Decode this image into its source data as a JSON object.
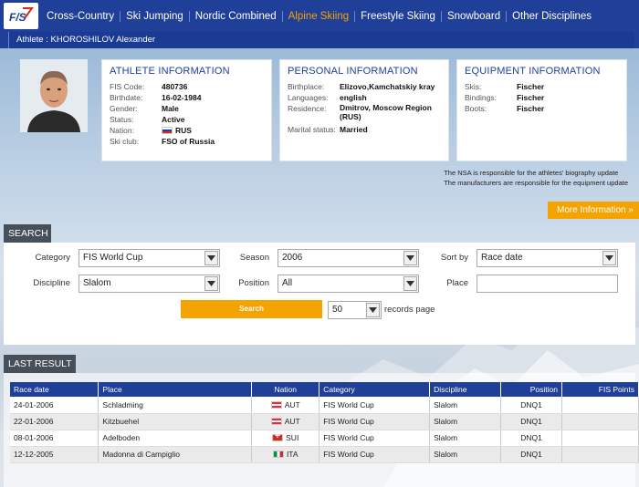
{
  "nav": {
    "logo_text": "FIS",
    "items": [
      {
        "label": "Cross-Country",
        "active": false
      },
      {
        "label": "Ski Jumping",
        "active": false
      },
      {
        "label": "Nordic Combined",
        "active": false
      },
      {
        "label": "Alpine Skiing",
        "active": true
      },
      {
        "label": "Freestyle Skiing",
        "active": false
      },
      {
        "label": "Snowboard",
        "active": false
      },
      {
        "label": "Other Disciplines",
        "active": false
      }
    ]
  },
  "athlete_bar": {
    "text": "Athlete : KHOROSHILOV Alexander"
  },
  "athlete_info": {
    "title": "ATHLETE INFORMATION",
    "fis_code_label": "FIS Code:",
    "fis_code": "480736",
    "birthdate_label": "Birthdate:",
    "birthdate": "16-02-1984",
    "gender_label": "Gender:",
    "gender": "Male",
    "status_label": "Status:",
    "status": "Active",
    "nation_label": "Nation:",
    "nation": "RUS",
    "club_label": "Ski club:",
    "club": "FSO of Russia"
  },
  "personal_info": {
    "title": "PERSONAL INFORMATION",
    "birthplace_label": "Birthplace:",
    "birthplace": "Elizovo,Kamchatskiy kray",
    "languages_label": "Languages:",
    "languages": "english",
    "residence_label": "Residence:",
    "residence": "Dmitrov, Moscow Region (RUS)",
    "marital_label": "Marital status:",
    "marital": "Married"
  },
  "equipment_info": {
    "title": "EQUIPMENT INFORMATION",
    "skis_label": "Skis:",
    "skis": "Fischer",
    "bindings_label": "Bindings:",
    "bindings": "Fischer",
    "boots_label": "Boots:",
    "boots": "Fischer"
  },
  "notes": {
    "nsa": "The NSA is responsible for the athletes' biography update",
    "manufacturers": "The manufacturers are responsible for the equipment update"
  },
  "more_info": "More Information  »",
  "search": {
    "section_label": "SEARCH",
    "category_label": "Category",
    "category_value": "FIS World Cup",
    "season_label": "Season",
    "season_value": "2006",
    "sortby_label": "Sort by",
    "sortby_value": "Race date",
    "discipline_label": "Discipline",
    "discipline_value": "Slalom",
    "position_label": "Position",
    "position_value": "All",
    "place_label": "Place",
    "place_value": "",
    "button_label": "Search",
    "records_value": "50",
    "records_label": "records page"
  },
  "results": {
    "section_label": "LAST RESULT",
    "headers": [
      "Race date",
      "Place",
      "Nation",
      "Category",
      "Discipline",
      "Position",
      "FIS Points"
    ],
    "rows": [
      {
        "date": "24-01-2006",
        "place": "Schladming",
        "nation": "AUT",
        "category": "FIS World Cup",
        "discipline": "Slalom",
        "position": "DNQ1",
        "points": ""
      },
      {
        "date": "22-01-2006",
        "place": "Kitzbuehel",
        "nation": "AUT",
        "category": "FIS World Cup",
        "discipline": "Slalom",
        "position": "DNQ1",
        "points": ""
      },
      {
        "date": "08-01-2006",
        "place": "Adelboden",
        "nation": "SUI",
        "category": "FIS World Cup",
        "discipline": "Slalom",
        "position": "DNQ1",
        "points": ""
      },
      {
        "date": "12-12-2005",
        "place": "Madonna di Campiglio",
        "nation": "ITA",
        "category": "FIS World Cup",
        "discipline": "Slalom",
        "position": "DNQ1",
        "points": ""
      }
    ]
  },
  "colors": {
    "brand": "#1f3f99",
    "accent": "#f5a300",
    "label_bg": "#47505a"
  }
}
